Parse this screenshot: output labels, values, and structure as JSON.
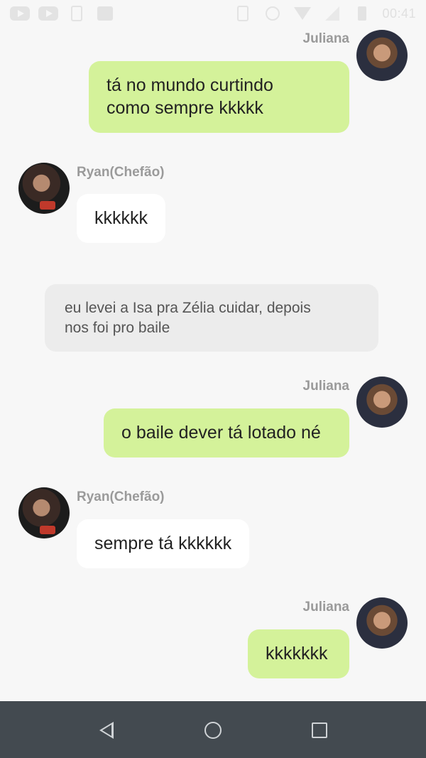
{
  "status_bar": {
    "time": "00:41",
    "left_icons": [
      "youtube-icon",
      "youtube-icon",
      "phone-icon",
      "image-icon"
    ],
    "right_icons": [
      "vibrate-icon",
      "alarm-icon",
      "wifi-icon",
      "signal-icon",
      "battery-icon"
    ]
  },
  "messages": [
    {
      "sender": "Juliana",
      "side": "right",
      "text_lines": [
        "tá no mundo curtindo",
        "como sempre kkkkk"
      ]
    },
    {
      "sender": "Ryan(Chefão)",
      "side": "left",
      "text_lines": [
        "kkkkkk"
      ]
    },
    {
      "sender": "",
      "side": "center",
      "text_lines": [
        "eu levei a Isa pra Zélia cuidar, depois",
        "nos foi pro baile"
      ]
    },
    {
      "sender": "Juliana",
      "side": "right",
      "text_lines": [
        "o baile dever tá lotado né"
      ]
    },
    {
      "sender": "Ryan(Chefão)",
      "side": "left",
      "text_lines": [
        "sempre tá kkkkkk"
      ]
    },
    {
      "sender": "Juliana",
      "side": "right",
      "text_lines": [
        "kkkkkkk"
      ]
    }
  ],
  "nav_bar": {
    "buttons": [
      "back-icon",
      "home-icon",
      "recent-apps-icon"
    ]
  },
  "colors": {
    "background": "#f7f7f7",
    "outgoing_bubble": "#d4f29a",
    "incoming_bubble": "#ffffff",
    "narration_bubble": "#ececec",
    "sender_name": "#9a9a9a",
    "nav_bar": "#434a50"
  }
}
